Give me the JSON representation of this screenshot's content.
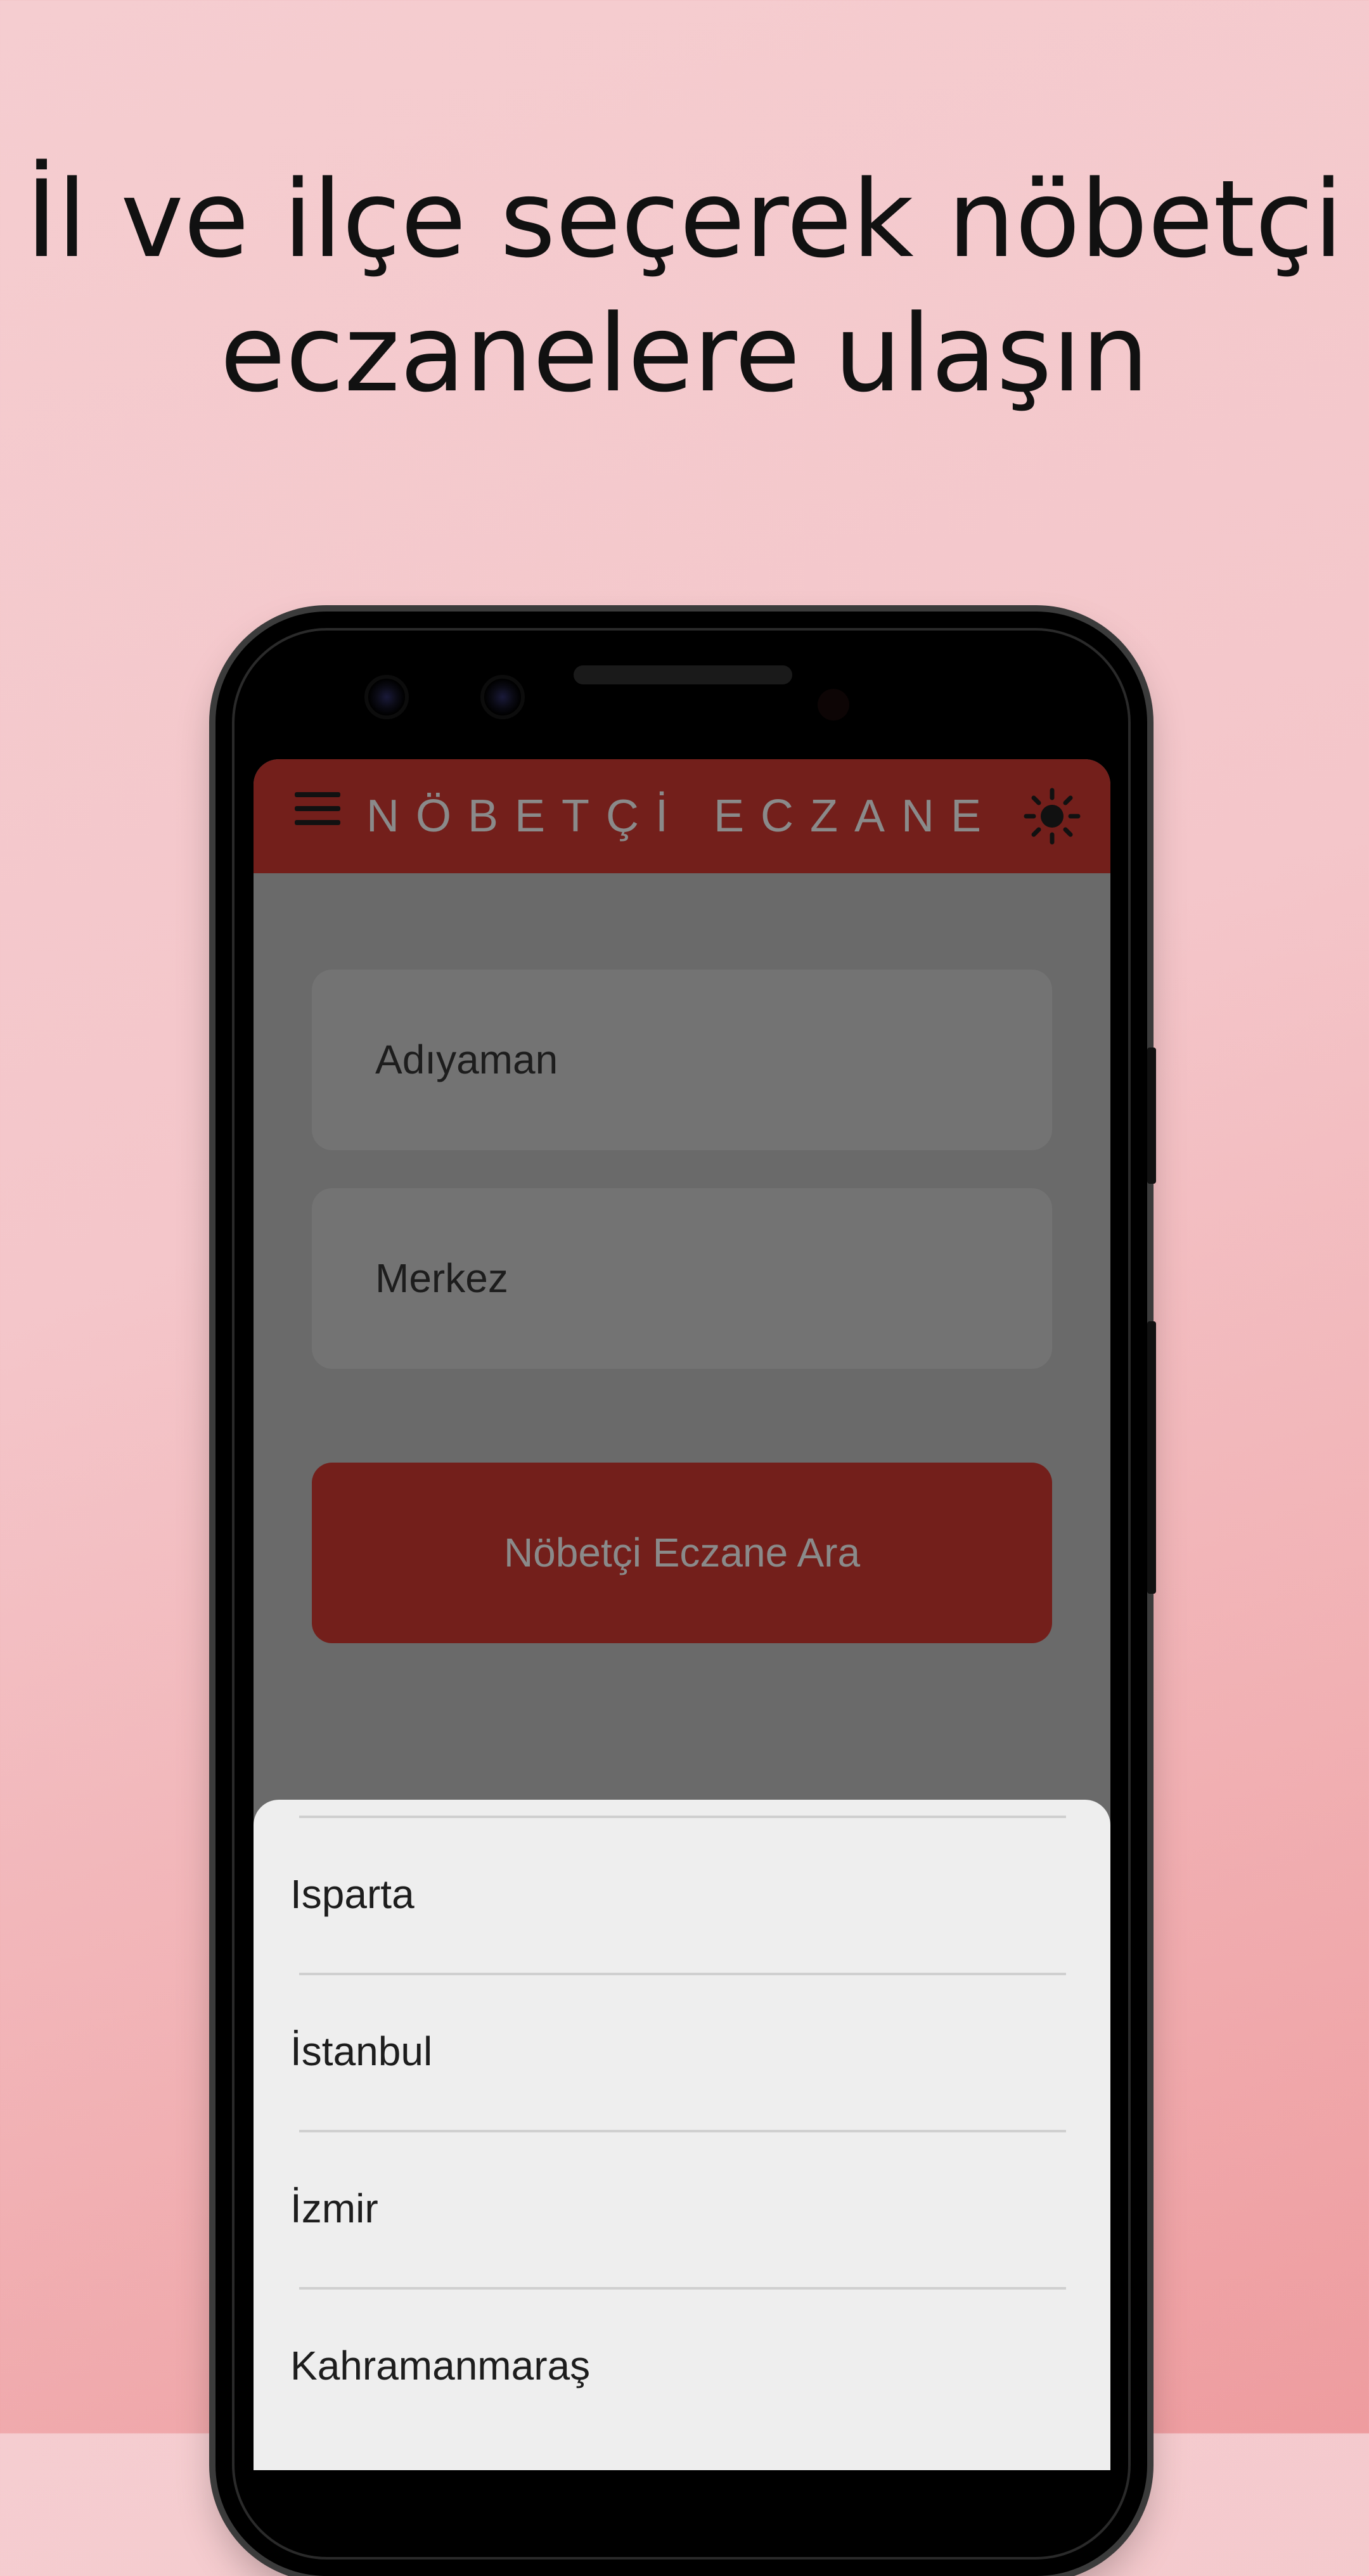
{
  "headline": {
    "line1": "İl ve ilçe seçerek nöbetçi",
    "line2": "eczanelere ulaşın"
  },
  "app": {
    "title": "NÖBETÇİ ECZANE",
    "menu_icon": "hamburger-menu-icon",
    "theme_icon": "sun-theme-icon",
    "accent_color": "#731f1b"
  },
  "form": {
    "city_value": "Adıyaman",
    "district_value": "Merkez",
    "search_button_label": "Nöbetçi Eczane Ara"
  },
  "city_picker": {
    "items": [
      "Isparta",
      "İstanbul",
      "İzmir",
      "Kahramanmaraş"
    ]
  }
}
